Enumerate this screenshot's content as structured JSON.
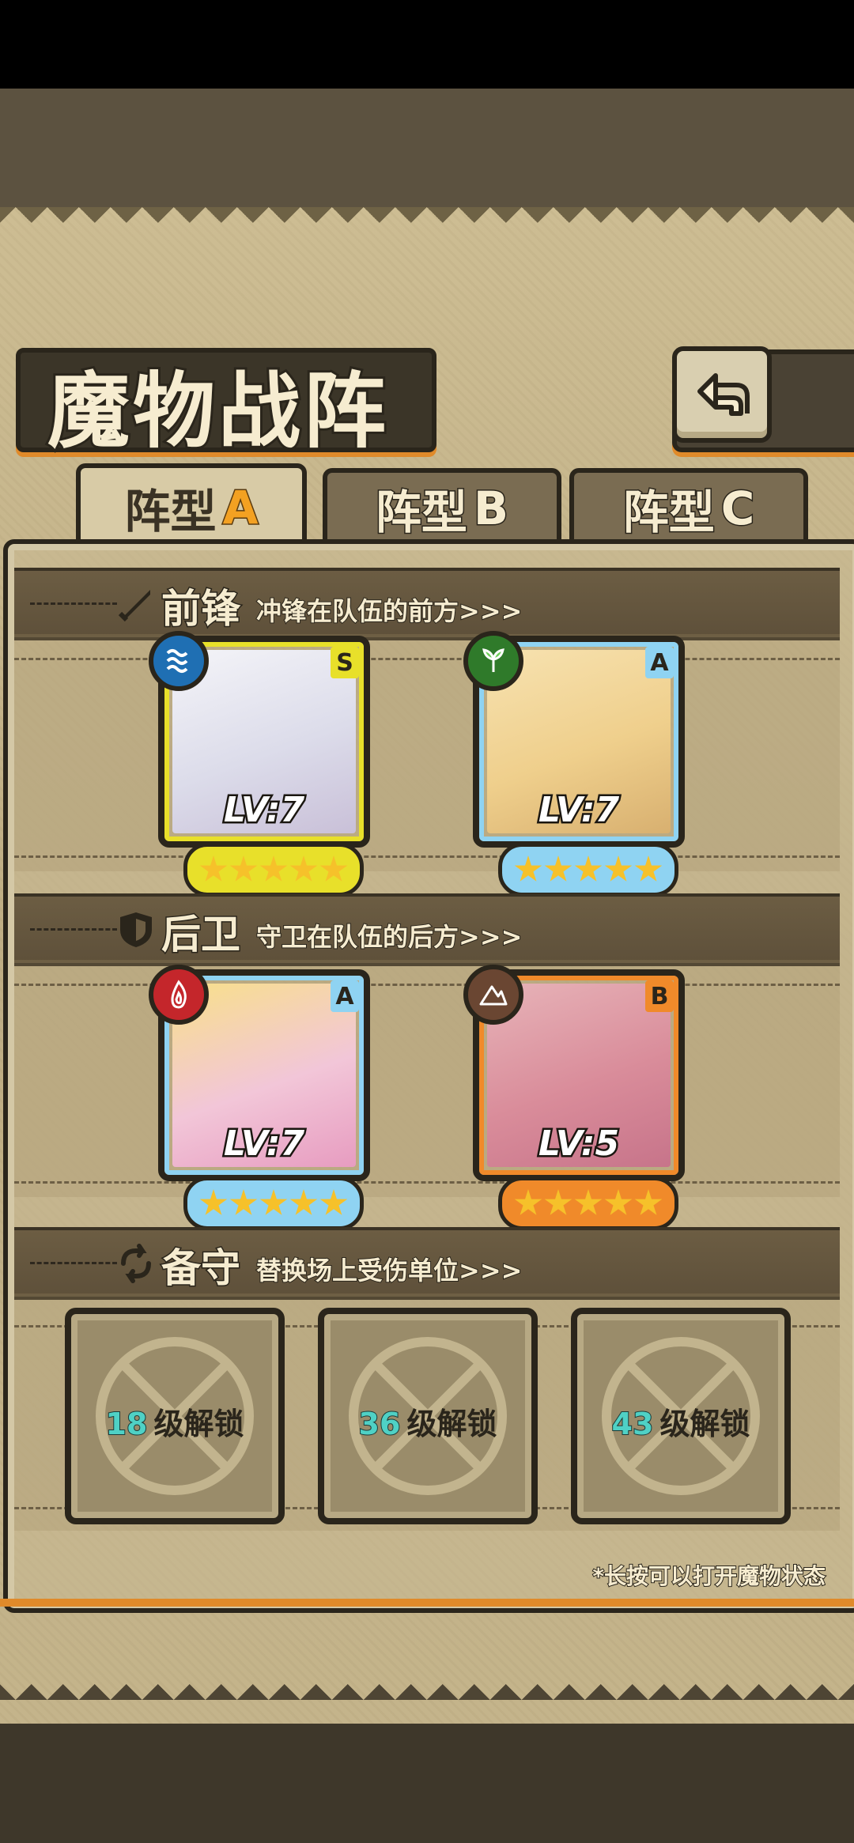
{
  "screen_title": "魔物战阵",
  "tabs": [
    {
      "prefix": "阵型",
      "letter": "A",
      "active": true
    },
    {
      "prefix": "阵型",
      "letter": "B",
      "active": false
    },
    {
      "prefix": "阵型",
      "letter": "C",
      "active": false
    }
  ],
  "sections": {
    "front": {
      "label": "前锋",
      "desc": "冲锋在队伍的前方>>>",
      "icon": "sword-icon"
    },
    "rear": {
      "label": "后卫",
      "desc": "守卫在队伍的后方>>>",
      "icon": "shield-icon"
    },
    "reserve": {
      "label": "备守",
      "desc": "替换场上受伤单位>>>",
      "icon": "swap-icon"
    }
  },
  "front_units": [
    {
      "rank": "S",
      "level": "LV:7",
      "element": "water-icon",
      "stars": 5,
      "frame_color": "#e8e02a",
      "element_color": "#1f6fb3"
    },
    {
      "rank": "A",
      "level": "LV:7",
      "element": "leaf-icon",
      "stars": 5,
      "frame_color": "#8fd3f2",
      "element_color": "#2f7a2a"
    }
  ],
  "rear_units": [
    {
      "rank": "A",
      "level": "LV:7",
      "element": "fire-icon",
      "stars": 5,
      "frame_color": "#8fd3f2",
      "element_color": "#c4262b"
    },
    {
      "rank": "B",
      "level": "LV:5",
      "element": "earth-icon",
      "stars": 5,
      "frame_color": "#f08a2a",
      "element_color": "#6a4632"
    }
  ],
  "reserve_slots": [
    {
      "unlock_level": "18",
      "unlock_text": "级解锁"
    },
    {
      "unlock_level": "36",
      "unlock_text": "级解锁"
    },
    {
      "unlock_level": "43",
      "unlock_text": "级解锁"
    }
  ],
  "hint": "*长按可以打开魔物状态",
  "back_icon": "return-arrow-icon"
}
